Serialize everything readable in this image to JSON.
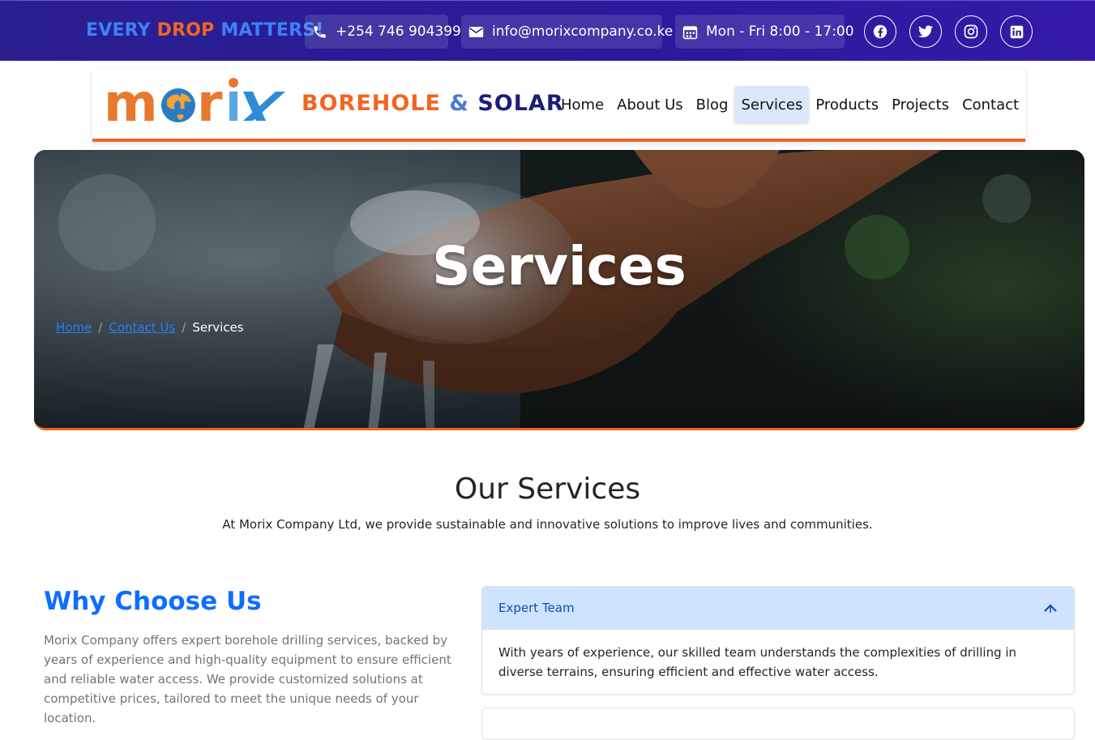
{
  "topbar": {
    "slogan": [
      "EVERY",
      "DROP",
      "MATTERS!"
    ],
    "phone": "+254 746 904399",
    "email": "info@morixcompany.co.ke",
    "hours": "Mon - Fri 8:00 - 17:00",
    "socials": [
      "facebook-icon",
      "twitter-icon",
      "instagram-icon",
      "linkedin-icon"
    ]
  },
  "brand": {
    "logo_text": "morix",
    "part1": "BOREHOLE",
    "amp": "&",
    "part2": "SOLAR"
  },
  "nav": {
    "items": [
      "Home",
      "About Us",
      "Blog",
      "Services",
      "Products",
      "Projects",
      "Contact"
    ],
    "active": "Services"
  },
  "hero": {
    "title": "Services",
    "breadcrumb": [
      "Home",
      "Contact Us",
      "Services"
    ]
  },
  "section": {
    "title": "Our Services",
    "subtitle": "At Morix Company Ltd, we provide sustainable and innovative solutions to improve lives and communities."
  },
  "why": {
    "title": "Why Choose Us",
    "text": "Morix Company offers expert borehole drilling services, backed by years of experience and high-quality equipment to ensure efficient and reliable water access. We provide customized solutions at competitive prices, tailored to meet the unique needs of your location."
  },
  "accordion": {
    "items": [
      {
        "title": "Expert Team",
        "body": "With years of experience, our skilled team understands the complexities of drilling in diverse terrains, ensuring efficient and effective water access.",
        "expanded": true
      }
    ]
  },
  "colors": {
    "topbar": "#2a1f8f",
    "accent_orange": "#f26522",
    "primary_blue": "#0d6efd",
    "accordion_header": "#cfe2ff"
  }
}
